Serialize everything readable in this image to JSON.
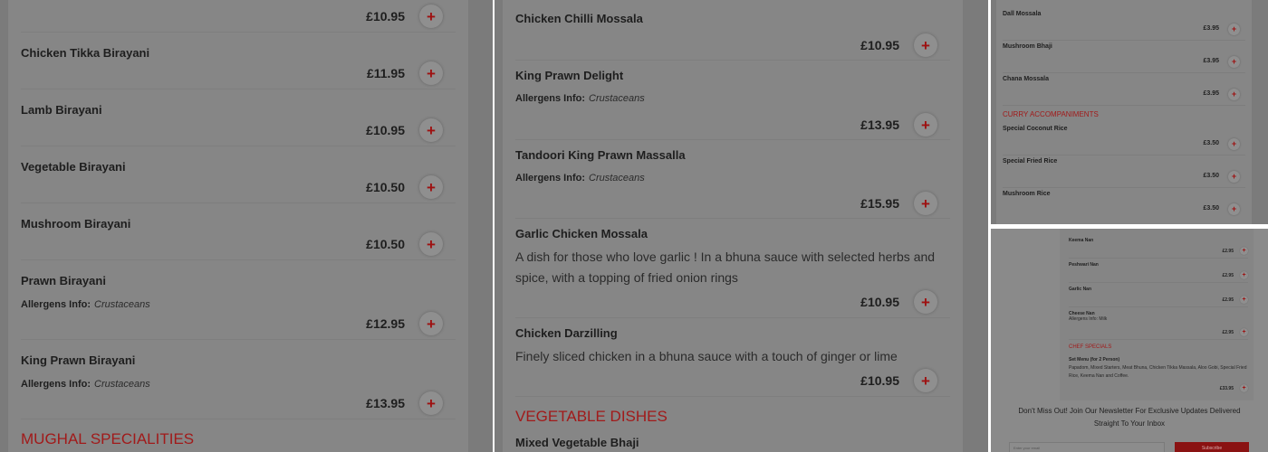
{
  "panel1": {
    "top_price": "£10.95",
    "items": [
      {
        "name": "Chicken Tikka Birayani",
        "price": "£11.95"
      },
      {
        "name": "Lamb Birayani",
        "price": "£10.95"
      },
      {
        "name": "Vegetable Birayani",
        "price": "£10.50"
      },
      {
        "name": "Mushroom Birayani",
        "price": "£10.50"
      },
      {
        "name": "Prawn Birayani",
        "allergens_label": "Allergens Info:",
        "allergens": "Crustaceans",
        "price": "£12.95"
      },
      {
        "name": "King Prawn Birayani",
        "allergens_label": "Allergens Info:",
        "allergens": "Crustaceans",
        "price": "£13.95"
      }
    ],
    "section_title": "MUGHAL SPECIALITIES"
  },
  "panel2": {
    "items": [
      {
        "name": "Chicken Chilli Mossala",
        "price": "£10.95"
      },
      {
        "name": "King Prawn Delight",
        "allergens_label": "Allergens Info:",
        "allergens": "Crustaceans",
        "price": "£13.95"
      },
      {
        "name": "Tandoori King Prawn Massalla",
        "allergens_label": "Allergens Info:",
        "allergens": "Crustaceans",
        "price": "£15.95"
      },
      {
        "name": "Garlic Chicken Mossala",
        "description": "A dish for those who love garlic ! In a bhuna sauce with selected herbs and spice, with a topping of fried onion rings",
        "price": "£10.95"
      },
      {
        "name": "Chicken Darzilling",
        "description": "Finely sliced chicken in a bhuna sauce with a touch of ginger or lime",
        "price": "£10.95"
      }
    ],
    "section_title": "VEGETABLE DISHES",
    "next_item": "Mixed Vegetable Bhaji"
  },
  "panel3": {
    "items": [
      {
        "name": "Dall Mossala",
        "price": "£3.95"
      },
      {
        "name": "Mushroom Bhaji",
        "price": "£3.95"
      },
      {
        "name": "Chana Mossala",
        "price": "£3.95"
      }
    ],
    "section_title": "CURRY ACCOMPANIMENTS",
    "items2": [
      {
        "name": "Special Coconut Rice",
        "price": "£3.50"
      },
      {
        "name": "Special Fried Rice",
        "price": "£3.50"
      },
      {
        "name": "Mushroom Rice",
        "price": "£3.50"
      }
    ]
  },
  "panel4": {
    "items": [
      {
        "name": "Keema Nan",
        "price": "£2.95"
      },
      {
        "name": "Peshwari Nan",
        "price": "£2.95"
      },
      {
        "name": "Garlic Nan",
        "price": "£2.95"
      },
      {
        "name": "Cheese Nan",
        "allergens": "Allergens Info: Milk",
        "price": "£2.95"
      }
    ],
    "section_title": "CHEF SPECIALS",
    "special": {
      "name": "Set Menu (for 2 Person)",
      "description": "Papadom, Mixed Starters, Meat Bhuna, Chicken Tikka Massala, Aloo Gobi, Special Fried Rice, Keema Nan and Coffee.",
      "price": "£33.95"
    },
    "newsletter_text": "Don't Miss Out! Join Our Newsletter For Exclusive Updates Delivered Straight To Your Inbox",
    "email_placeholder": "Enter your email",
    "subscribe_label": "Subscribe"
  },
  "colors": {
    "accent": "#a11a1a",
    "overlay": "#7b7b7b",
    "plus": "#9e1010"
  }
}
